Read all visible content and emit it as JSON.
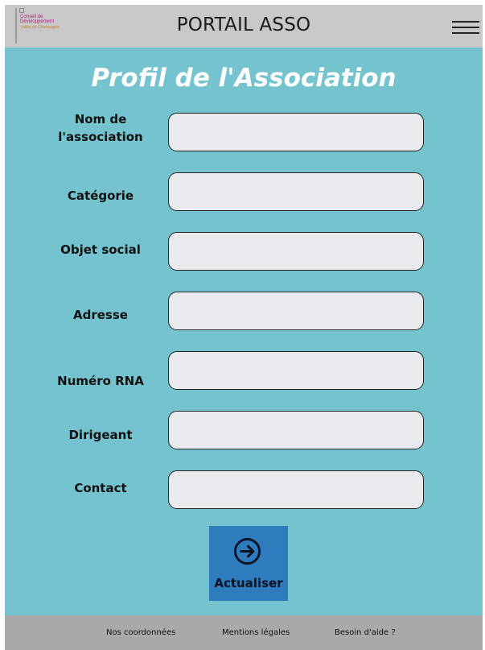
{
  "header": {
    "logo": {
      "line1": "Conseil de",
      "line2": "Développement",
      "line3": "Vallée de Champagne"
    },
    "title": "PORTAIL ASSO",
    "menu_icon": "hamburger-menu-icon"
  },
  "main": {
    "title": "Profil de l'Association",
    "fields": [
      {
        "label": "Nom de l'association",
        "value": ""
      },
      {
        "label": "Catégorie",
        "value": ""
      },
      {
        "label": "Objet social",
        "value": ""
      },
      {
        "label": "Adresse",
        "value": ""
      },
      {
        "label": "Numéro RNA",
        "value": ""
      },
      {
        "label": "Dirigeant",
        "value": ""
      },
      {
        "label": "Contact",
        "value": ""
      }
    ],
    "submit": {
      "label": "Actualiser",
      "icon": "arrow-right-circle-icon"
    }
  },
  "footer": {
    "links": [
      "Nos coordonnées",
      "Mentions légales",
      "Besoin d'aide ?"
    ]
  },
  "colors": {
    "header_bg": "#c8c8c8",
    "main_bg": "#74c3cf",
    "title_color": "#ffffff",
    "field_bg": "#e8eaed",
    "button_bg": "#2e7bbd",
    "footer_bg": "#a9a9a9"
  }
}
